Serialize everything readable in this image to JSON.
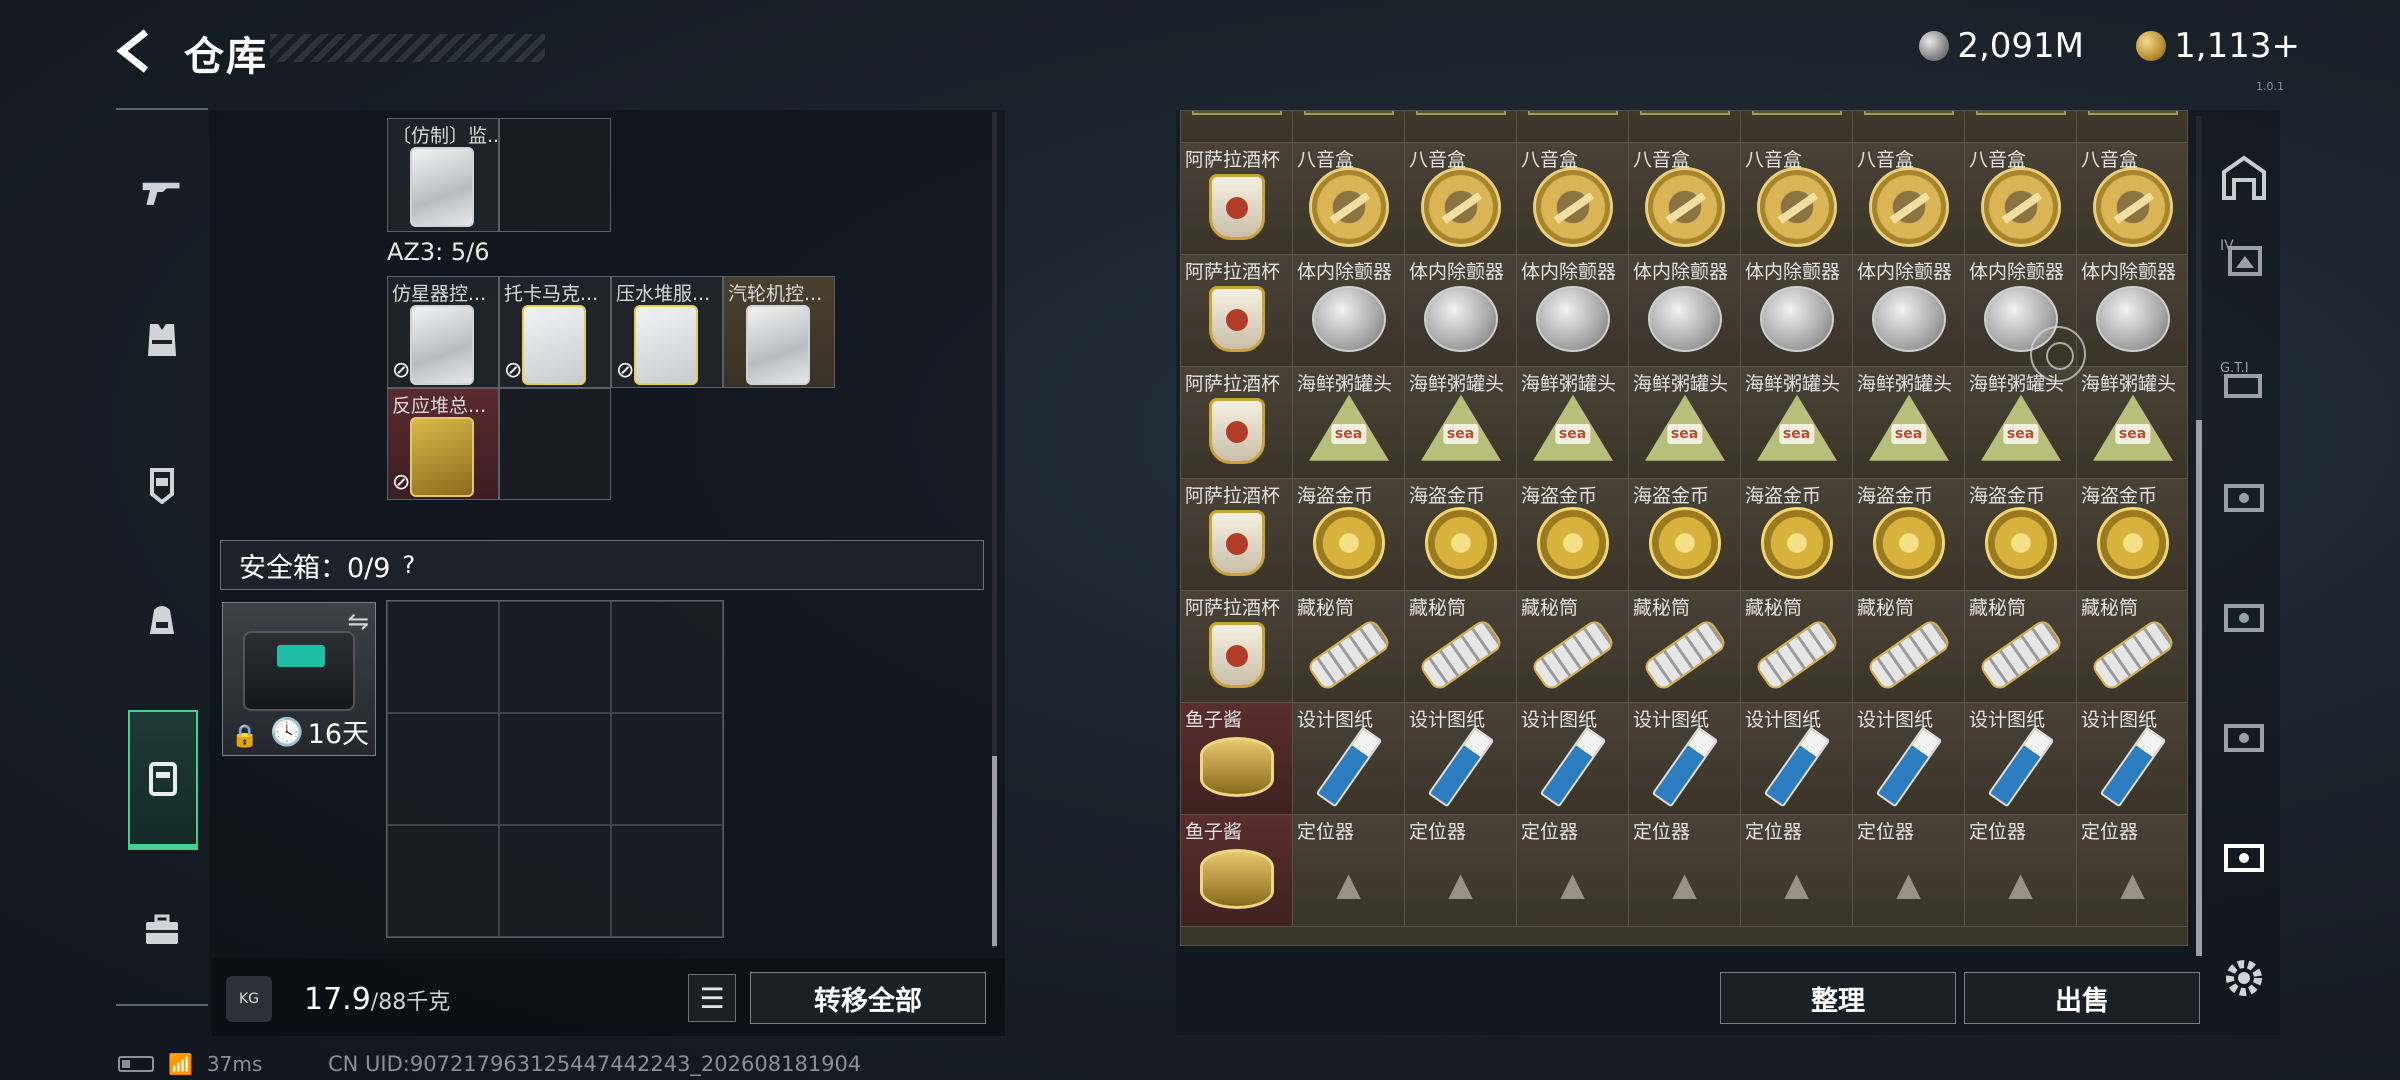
{
  "header": {
    "title": "仓库",
    "currency1": "2,091M",
    "currency2": "1,113+",
    "version": "1.0.1"
  },
  "left_nav": {
    "items": [
      {
        "name": "weapon-icon"
      },
      {
        "name": "vest-icon"
      },
      {
        "name": "armor-icon"
      },
      {
        "name": "backpack-icon"
      },
      {
        "name": "safebox-tab-icon",
        "active": true
      },
      {
        "name": "toolbox-icon"
      }
    ]
  },
  "container": {
    "item_top": "〔仿制〕监...",
    "az3_label": "AZ3: 5/6",
    "az3_items": [
      "仿星器控...",
      "托卡马克...",
      "压水堆服...",
      "汽轮机控..."
    ],
    "extra_item": "反应堆总..."
  },
  "safebox": {
    "title": "安全箱：0/9",
    "help": "?",
    "days": "16天"
  },
  "bottom_left": {
    "weight": "17.9",
    "capacity": "/88千克",
    "kg_icon": "KG",
    "transfer_all": "转移全部"
  },
  "status": {
    "ping": "37ms",
    "uid": "CN UID:907217963125447442243_202608181904"
  },
  "storage": {
    "first_column": [
      "阿萨拉酒杯",
      "阿萨拉酒杯",
      "阿萨拉酒杯",
      "阿萨拉酒杯",
      "阿萨拉酒杯",
      "鱼子酱",
      "鱼子酱"
    ],
    "rows": [
      {
        "label": "八音盒",
        "icon": "musicbox"
      },
      {
        "label": "体内除颤器",
        "icon": "detector"
      },
      {
        "label": "海鲜粥罐头",
        "icon": "seafood"
      },
      {
        "label": "海盗金币",
        "icon": "coin"
      },
      {
        "label": "藏秘筒",
        "icon": "cylinder"
      },
      {
        "label": "设计图纸",
        "icon": "blueprint"
      },
      {
        "label": "定位器",
        "icon": "locator"
      }
    ],
    "seafood_label": "sea"
  },
  "buttons": {
    "sort": "整理",
    "sell": "出售"
  },
  "colors": {
    "accent": "#45d08f",
    "cell_bg": "#4a4236",
    "red_cell": "#5a2e2c"
  }
}
